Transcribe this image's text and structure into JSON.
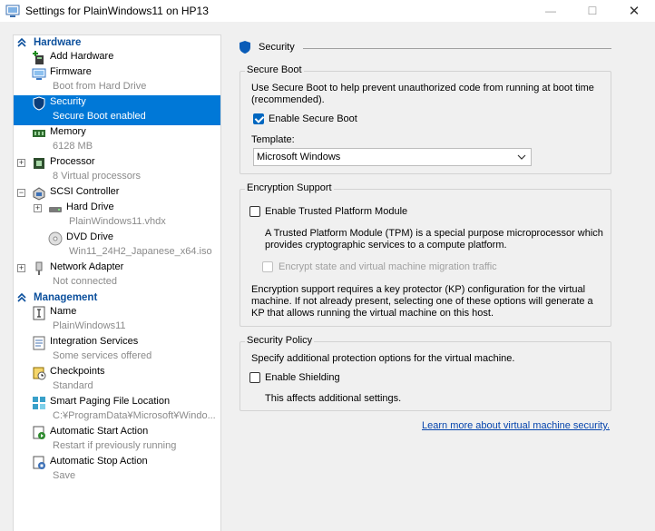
{
  "window": {
    "title": "Settings for PlainWindows11 on HP13",
    "minimize": "—",
    "maximize": "☐",
    "close": "✕"
  },
  "nav": {
    "hardware_header": "Hardware",
    "management_header": "Management",
    "hardware_items": [
      {
        "label": "Add Hardware",
        "sub": ""
      },
      {
        "label": "Firmware",
        "sub": "Boot from Hard Drive"
      },
      {
        "label": "Security",
        "sub": "Secure Boot enabled"
      },
      {
        "label": "Memory",
        "sub": "6128 MB"
      },
      {
        "label": "Processor",
        "sub": "8 Virtual processors"
      },
      {
        "label": "SCSI Controller",
        "sub": ""
      },
      {
        "label": "Hard Drive",
        "sub": "PlainWindows11.vhdx"
      },
      {
        "label": "DVD Drive",
        "sub": "Win11_24H2_Japanese_x64.iso"
      },
      {
        "label": "Network Adapter",
        "sub": "Not connected"
      }
    ],
    "management_items": [
      {
        "label": "Name",
        "sub": "PlainWindows11"
      },
      {
        "label": "Integration Services",
        "sub": "Some services offered"
      },
      {
        "label": "Checkpoints",
        "sub": "Standard"
      },
      {
        "label": "Smart Paging File Location",
        "sub": "C:¥ProgramData¥Microsoft¥Windo..."
      },
      {
        "label": "Automatic Start Action",
        "sub": "Restart if previously running"
      },
      {
        "label": "Automatic Stop Action",
        "sub": "Save"
      }
    ],
    "expander_plus": "+",
    "expander_minus": "−"
  },
  "security": {
    "title": "Security",
    "secure_boot": {
      "title": "Secure Boot",
      "description": "Use Secure Boot to help prevent unauthorized code from running at boot time (recommended).",
      "enable_label": "Enable Secure Boot",
      "enable_checked": true,
      "template_label": "Template:",
      "template_value": "Microsoft Windows"
    },
    "encryption": {
      "title": "Encryption Support",
      "tpm_label": "Enable Trusted Platform Module",
      "tpm_checked": false,
      "tpm_description": "A Trusted Platform Module (TPM) is a special purpose microprocessor which provides cryptographic services to a compute platform.",
      "encrypt_label": "Encrypt state and virtual machine migration traffic",
      "kp_description": "Encryption support requires a key protector (KP) configuration for the virtual machine. If not already present, selecting one of these options will generate a KP that allows running the virtual machine on this host."
    },
    "policy": {
      "title": "Security Policy",
      "description": "Specify additional protection options for the virtual machine.",
      "shielding_label": "Enable Shielding",
      "shielding_checked": false,
      "shielding_note": "This affects additional settings."
    },
    "learn_more": "Learn more about virtual machine security."
  },
  "colors": {
    "selection": "#0078d7",
    "header_blue": "#0b4f9c",
    "checkbox_blue": "#0067c0",
    "link": "#0645ad"
  }
}
